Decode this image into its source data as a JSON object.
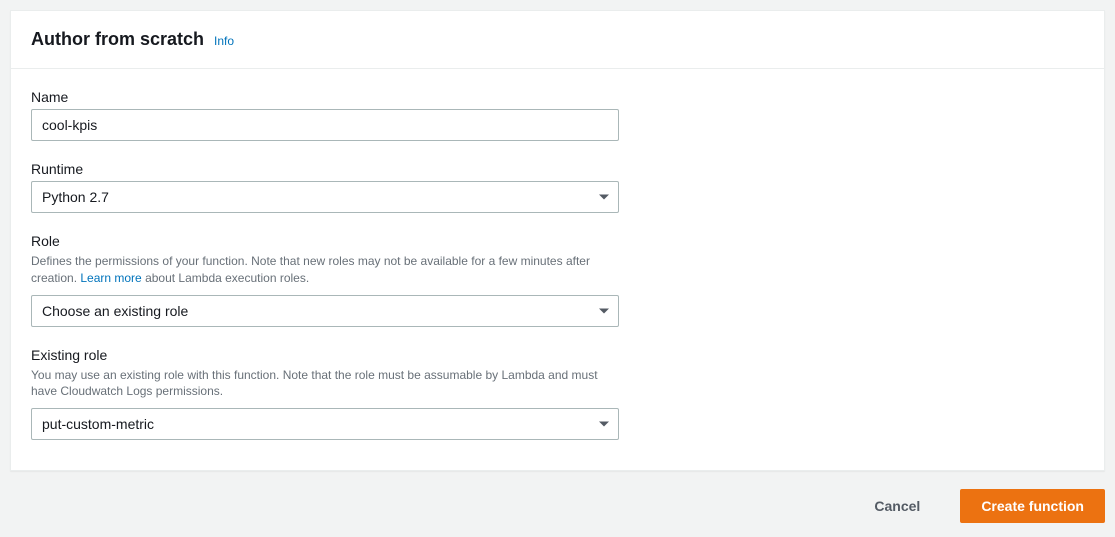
{
  "header": {
    "title": "Author from scratch",
    "info_label": "Info"
  },
  "form": {
    "name": {
      "label": "Name",
      "value": "cool-kpis"
    },
    "runtime": {
      "label": "Runtime",
      "value": "Python 2.7"
    },
    "role": {
      "label": "Role",
      "description_pre": "Defines the permissions of your function. Note that new roles may not be available for a few minutes after creation. ",
      "learn_more": "Learn more",
      "description_post": " about Lambda execution roles.",
      "value": "Choose an existing role"
    },
    "existing_role": {
      "label": "Existing role",
      "description": "You may use an existing role with this function. Note that the role must be assumable by Lambda and must have Cloudwatch Logs permissions.",
      "value": "put-custom-metric"
    }
  },
  "footer": {
    "cancel": "Cancel",
    "create": "Create function"
  }
}
